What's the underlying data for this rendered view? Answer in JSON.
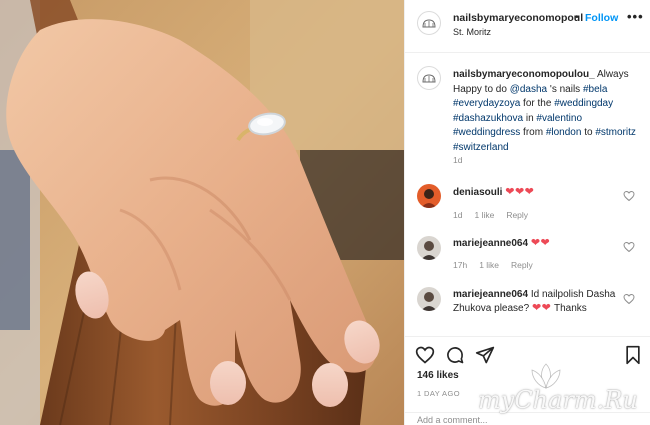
{
  "post": {
    "username": "nailsbymaryeconomopoul",
    "dot": "•",
    "follow_label": "Follow",
    "location": "St. Moritz",
    "more_label": "•••"
  },
  "caption": {
    "username": "nailsbymaryeconomopoulou_",
    "text_1": "Always Happy to do",
    "mention": "@dasha",
    "text_2": "'s nails",
    "hashtags_1": "#bela #everydayzoya",
    "text_3": "for the",
    "hashtags_2": "#weddingday #dashazukhova",
    "text_4": "in",
    "hashtags_3": "#valentino #weddingdress",
    "text_5": "from",
    "hashtags_4": "#london",
    "text_6": "to",
    "hashtags_5": "#stmoritz #switzerland",
    "time": "1d"
  },
  "comments": [
    {
      "username": "deniasouli",
      "text": "",
      "hearts": "❤❤❤",
      "time": "1d",
      "likes": "1 like",
      "reply": "Reply"
    },
    {
      "username": "mariejeanne064",
      "text": "",
      "hearts": "❤❤",
      "time": "17h",
      "likes": "1 like",
      "reply": "Reply"
    },
    {
      "username": "mariejeanne064",
      "text": "Id nailpolish Dasha Zhukova please?",
      "hearts": "❤❤",
      "text_after": "Thanks"
    }
  ],
  "actions": {
    "likes": "146 likes",
    "date": "1 DAY AGO",
    "add_comment_placeholder": "Add a comment..."
  },
  "watermark": {
    "text": "myCharm.Ru"
  },
  "colors": {
    "accent": "#0095f6",
    "heart": "#ed4956",
    "hashtag": "#00376b",
    "muted": "#8e8e8e"
  },
  "icons": [
    "more-icon",
    "heart-icon",
    "comment-icon",
    "share-icon",
    "bookmark-icon",
    "brand-logo-icon",
    "lotus-icon"
  ]
}
